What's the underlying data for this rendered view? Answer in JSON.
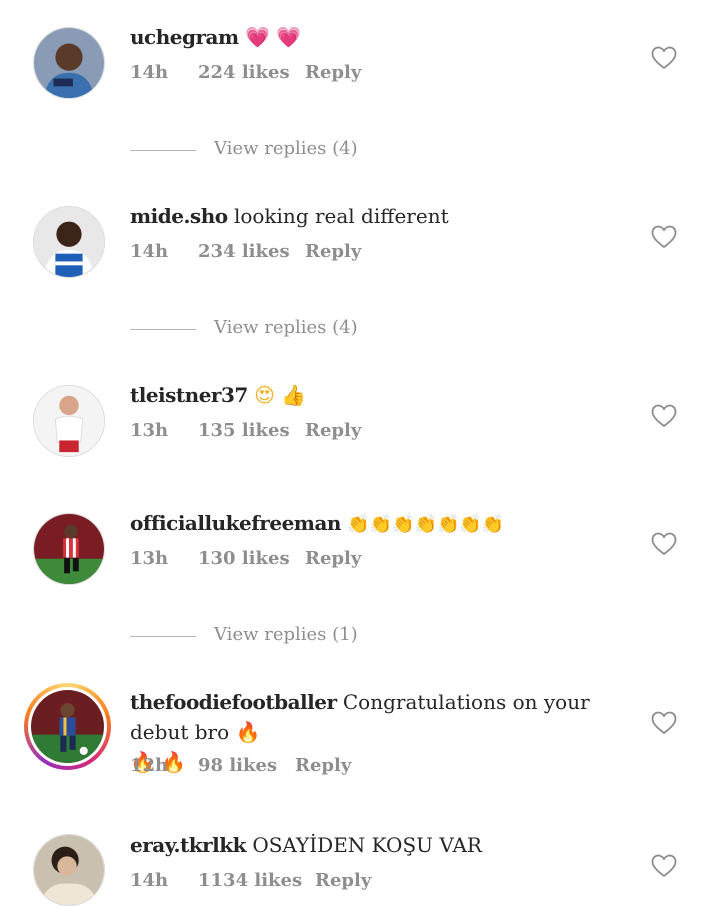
{
  "comments": [
    {
      "username": "uchegram",
      "text": "",
      "emoji": "💗 💗",
      "time": "14h",
      "likes": "224 likes",
      "reply": "Reply",
      "avatar_icon": "profile-photo"
    },
    {
      "username": "mide.sho",
      "text": "looking real different",
      "emoji": "",
      "time": "14h",
      "likes": "234 likes",
      "reply": "Reply",
      "avatar_icon": "profile-photo"
    },
    {
      "username": "tleistner37",
      "text": "",
      "emoji": "😍 👍",
      "time": "13h",
      "likes": "135 likes",
      "reply": "Reply",
      "avatar_icon": "profile-photo"
    },
    {
      "username": "officiallukefreeman",
      "text": "",
      "emoji": "👏👏👏👏👏👏👏",
      "time": "13h",
      "likes": "130 likes",
      "reply": "Reply",
      "avatar_icon": "profile-photo"
    },
    {
      "username": "thefoodiefootballer",
      "text": "Congratulations on your debut bro",
      "emoji": "🔥",
      "emoji2": "🔥 🔥",
      "time": "12h",
      "likes": "98 likes",
      "reply": "Reply",
      "avatar_icon": "profile-photo-story-ring"
    },
    {
      "username": "eray.tkrlkk",
      "text": "OSAYİDEN KOŞU VAR",
      "emoji": "",
      "time": "14h",
      "likes": "1134 likes",
      "reply": "Reply",
      "avatar_icon": "profile-photo"
    }
  ],
  "view_replies": [
    {
      "label": "View replies (4)"
    },
    {
      "label": "View replies (4)"
    },
    {
      "label": "View replies (1)"
    }
  ],
  "colors": {
    "meta": "#8e8e8e",
    "text": "#262626",
    "heart_stroke": "#8e8e8e"
  }
}
